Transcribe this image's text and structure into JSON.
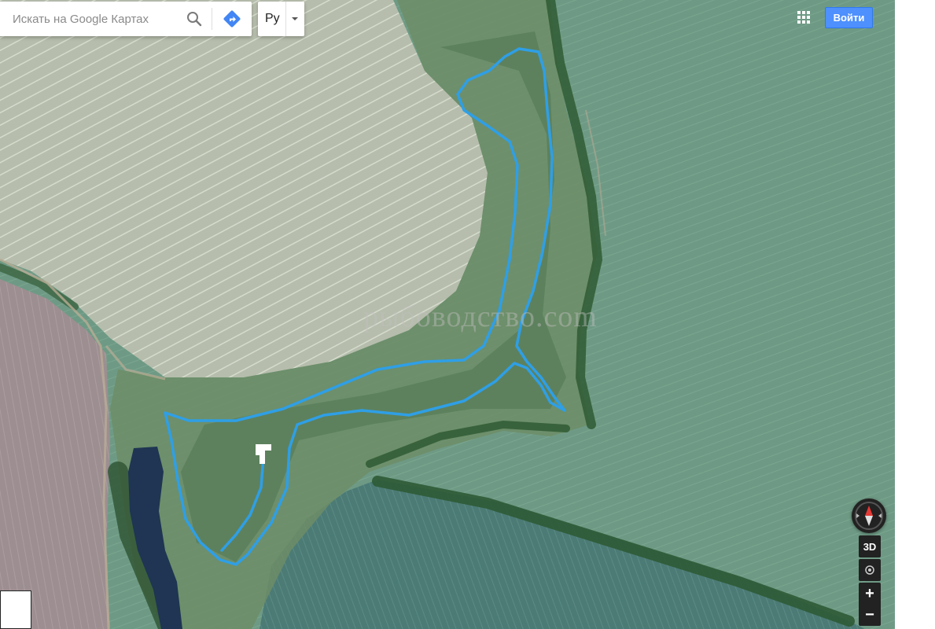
{
  "search": {
    "placeholder": "Искать на Google Картах"
  },
  "language": {
    "label": "Ру"
  },
  "header": {
    "signin_label": "Войти"
  },
  "watermark": "рыбоводство.com",
  "controls": {
    "three_d_label": "3D",
    "zoom_in_label": "+",
    "zoom_out_label": "−"
  },
  "icons": {
    "search": "search-icon",
    "directions": "directions-icon",
    "dropdown": "chevron-down-icon",
    "apps": "apps-grid-icon",
    "compass": "compass-icon",
    "location": "my-location-icon"
  },
  "colors": {
    "route": "#2f9fe6",
    "signin_button": "#4d90fe",
    "directions": "#4285f4",
    "field_pale": "#b7bfad",
    "field_green": "#6f9a84",
    "field_mauve": "#9e8e92",
    "field_teal": "#4f7e78"
  }
}
